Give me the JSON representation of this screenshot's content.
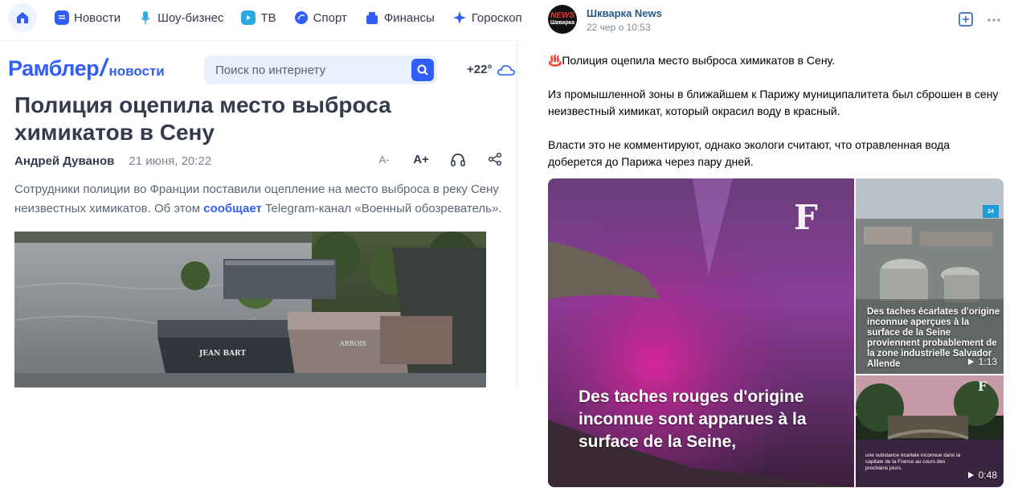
{
  "rambler": {
    "nav": [
      {
        "label": "Новости",
        "icon": "news-icon",
        "color": "#315efb"
      },
      {
        "label": "Шоу-бизнес",
        "icon": "microphone-icon",
        "color": "#2aa8e0"
      },
      {
        "label": "ТВ",
        "icon": "tv-icon",
        "color": "#2aa8e0"
      },
      {
        "label": "Спорт",
        "icon": "sport-icon",
        "color": "#315efb"
      },
      {
        "label": "Финансы",
        "icon": "finance-icon",
        "color": "#315efb"
      },
      {
        "label": "Гороскоп",
        "icon": "star-icon",
        "color": "#315efb"
      }
    ],
    "logo": {
      "main": "Рамблер",
      "slash": "/",
      "sub": "новости"
    },
    "search_placeholder": "Поиск по интернету",
    "weather": "+22°",
    "article": {
      "title": "Полиция оцепила место выброса химикатов в Сену",
      "author": "Андрей Дуванов",
      "date": "21 июня, 20:22",
      "font_smaller": "A-",
      "font_bigger": "A+",
      "lead_before": "Сотрудники полиции во Франции поставили оцепление на место выброса в реку Сену неизвестных химикатов. Об этом ",
      "lead_link": "сообщает",
      "lead_after": " Telegram-канал «Военный обозреватель».",
      "boat1_name": "JEAN BART",
      "boat2_name": "ARBOIS"
    },
    "accent": "#315efb"
  },
  "vk": {
    "author": "Шкварка News",
    "date": "22 чер о 10:53",
    "avatar_top": "NEWS",
    "avatar_bottom": "Шкварка",
    "paragraphs": [
      "♨️Полиция оцепила место выброса химикатов в Сену.",
      "Из промышленной зоны в ближайшем к Парижу муниципалитета был сброшен в сену неизвестный химикат, который окрасил воду в красный.",
      "Власти это не комментируют, однако экологи считают, что отравленная вода доберется до Парижа через пару дней."
    ],
    "media": {
      "main_caption": "Des taches rouges d'origine inconnue sont apparues à la surface de la Seine,",
      "top_caption": "Des taches écarlates d'origine inconnue aperçues à la surface de la Seine proviennent probablement de la zone industrielle Salvador Allende",
      "top_duration": "1:13",
      "top_badge": "24",
      "bottom_caption": "une substance écarlate inconnue dans la capitale de la France au cours des prochains jours.",
      "bottom_duration": "0:48",
      "logo_letter": "F"
    },
    "link_color": "#2a5885"
  }
}
